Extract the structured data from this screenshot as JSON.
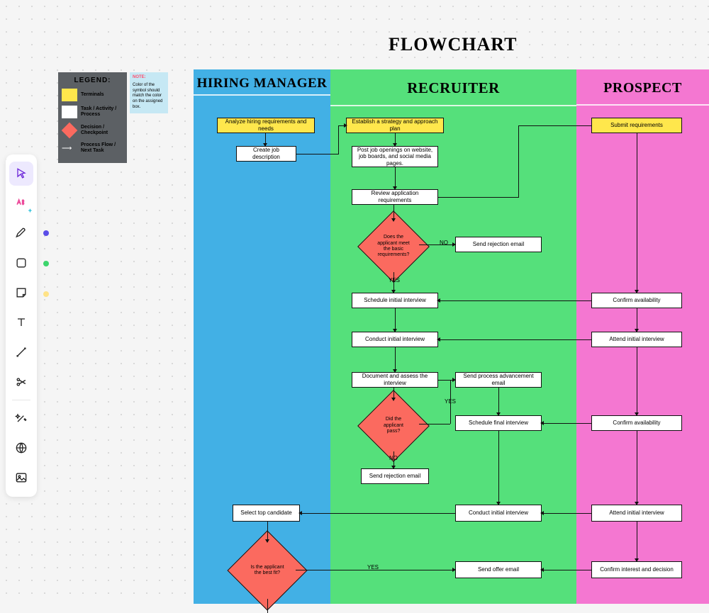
{
  "title": "FLOWCHART",
  "legend": {
    "heading": "LEGEND:",
    "terminals": "Terminals",
    "process": "Task / Activity / Process",
    "decision": "Decision / Checkpoint",
    "flow": "Process Flow / Next Task"
  },
  "note": {
    "heading": "NOTE:",
    "body": "Color of the symbol should match the color on the assigned box."
  },
  "lanes": {
    "hm": "HIRING MANAGER",
    "rec": "RECRUITER",
    "pros": "PROSPECT"
  },
  "nodes": {
    "hm_analyze": "Analyze hiring requirements and needs",
    "hm_create": "Create job description",
    "hm_select": "Select top candidate",
    "hm_bestfit": "Is the applicant the best fit?",
    "rec_strategy": "Establish a strategy and approach plan",
    "rec_post": "Post job openings on website, job boards, and social media pages.",
    "rec_review": "Review application requirements",
    "rec_basic": "Does the applicant meet the basic requirements?",
    "rec_rejection1": "Send rejection email",
    "rec_schedule": "Schedule initial interview",
    "rec_conduct": "Conduct initial interview",
    "rec_document": "Document and assess the interview",
    "rec_pass": "Did the applicant pass?",
    "rec_advancement": "Send process advancement email",
    "rec_schedulefinal": "Schedule final interview",
    "rec_rejection2": "Send rejection email",
    "rec_conduct2": "Conduct initial interview",
    "rec_offer": "Send offer email",
    "pros_submit": "Submit requirements",
    "pros_confirm1": "Confirm availability",
    "pros_attend1": "Attend initial interview",
    "pros_confirm2": "Confirm availability",
    "pros_attend2": "Attend initial interview",
    "pros_interest": "Confirm interest and decision"
  },
  "labels": {
    "yes": "YES",
    "no": "NO"
  }
}
